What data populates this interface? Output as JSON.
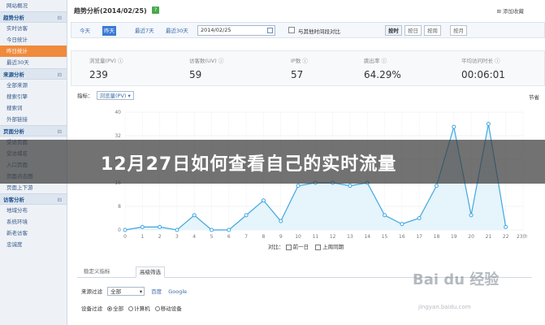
{
  "sidebar": {
    "top_item": "网站概况",
    "groups": [
      {
        "label": "趋势分析",
        "items": [
          "实时访客",
          "今日统计",
          "昨日统计",
          "最近30天"
        ]
      },
      {
        "label": "来源分析",
        "items": [
          "全部来源",
          "搜索引擎",
          "搜索词",
          "外部链接"
        ]
      },
      {
        "label": "页面分析",
        "items": [
          "受访页面",
          "受访域名",
          "入口页面",
          "页面点击图",
          "页面上下游"
        ]
      },
      {
        "label": "访客分析",
        "items": [
          "地域分布",
          "系统环境",
          "新老访客",
          "忠诚度"
        ]
      }
    ],
    "active_item": "昨日统计"
  },
  "header": {
    "title": "趋势分析(2014/02/25)",
    "help_badge": "?",
    "toolbar_link": "⊞ 添加收藏"
  },
  "date_bar": {
    "buttons": [
      "今天",
      "昨天",
      "最近7天",
      "最近30天"
    ],
    "active": "昨天",
    "date_value": "2014/02/25",
    "compare_label": "与其他时间段对比",
    "group_buttons": [
      "按时",
      "按日",
      "按周",
      "按月"
    ],
    "group_active": "按时"
  },
  "metrics": [
    {
      "label": "浏览量(PV) ⓘ",
      "value": "239"
    },
    {
      "label": "访客数(UV) ⓘ",
      "value": "59"
    },
    {
      "label": "IP数 ⓘ",
      "value": "57"
    },
    {
      "label": "跳出率 ⓘ",
      "value": "64.29%"
    },
    {
      "label": "平均访问时长 ⓘ",
      "value": "00:06:01"
    }
  ],
  "indicator": {
    "label": "指标：",
    "selected": "浏览量(PV)",
    "right_label": "节省"
  },
  "chart_data": {
    "type": "line",
    "x": [
      "0",
      "1",
      "2",
      "3",
      "4",
      "5",
      "6",
      "7",
      "8",
      "9",
      "10",
      "11",
      "12",
      "13",
      "14",
      "15",
      "16",
      "17",
      "18",
      "19",
      "20",
      "21",
      "22",
      "23(h)"
    ],
    "series": [
      {
        "values": [
          0,
          1,
          1,
          0,
          5,
          0,
          0,
          5,
          10,
          3,
          15,
          16,
          16,
          15,
          16,
          5,
          2,
          4,
          15,
          35,
          5,
          36,
          1
        ]
      }
    ],
    "y_ticks": [
      "0",
      "8",
      "16",
      "24",
      "32",
      "40"
    ],
    "ylim": [
      0,
      40
    ],
    "color": "#3fa7e0",
    "fill": "#e6f4fb",
    "grid": true
  },
  "compare": {
    "label": "对比：",
    "opt1": "前一日",
    "opt2": "上周同期"
  },
  "tabs": {
    "items": [
      "稳定义指标",
      "高级筛选"
    ],
    "active": "高级筛选"
  },
  "filters": {
    "source_label": "来源过滤",
    "source_value": "全部",
    "source_links": [
      "百度",
      "Google"
    ],
    "device_label": "设备过滤",
    "device_options": [
      "全部",
      "计算机",
      "移动设备"
    ],
    "device_active": "全部"
  },
  "banner": {
    "text": "12月27日如何查看自己的实时流量"
  },
  "watermark": {
    "brand": "Bai du 经验",
    "url": "jingyan.baidu.com"
  }
}
